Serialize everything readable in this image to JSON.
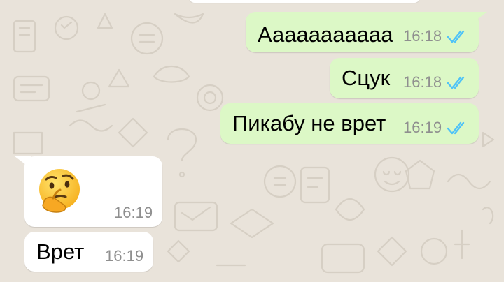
{
  "chat": {
    "messages": [
      {
        "text": "Ааааааааааа",
        "time": "16:18",
        "direction": "outgoing",
        "status_icon": "double-check-icon"
      },
      {
        "text": "Сцук",
        "time": "16:18",
        "direction": "outgoing",
        "status_icon": "double-check-icon"
      },
      {
        "text": "Пикабу не врет",
        "time": "16:19",
        "direction": "outgoing",
        "status_icon": "double-check-icon"
      },
      {
        "emoji": "thinking-face",
        "time": "16:19",
        "direction": "incoming"
      },
      {
        "text": "Врет",
        "time": "16:19",
        "direction": "incoming"
      }
    ]
  },
  "colors": {
    "outgoing_bubble": "#dcf8c6",
    "incoming_bubble": "#ffffff",
    "read_ticks": "#4fc3f7",
    "wallpaper": "#e9e3da"
  }
}
